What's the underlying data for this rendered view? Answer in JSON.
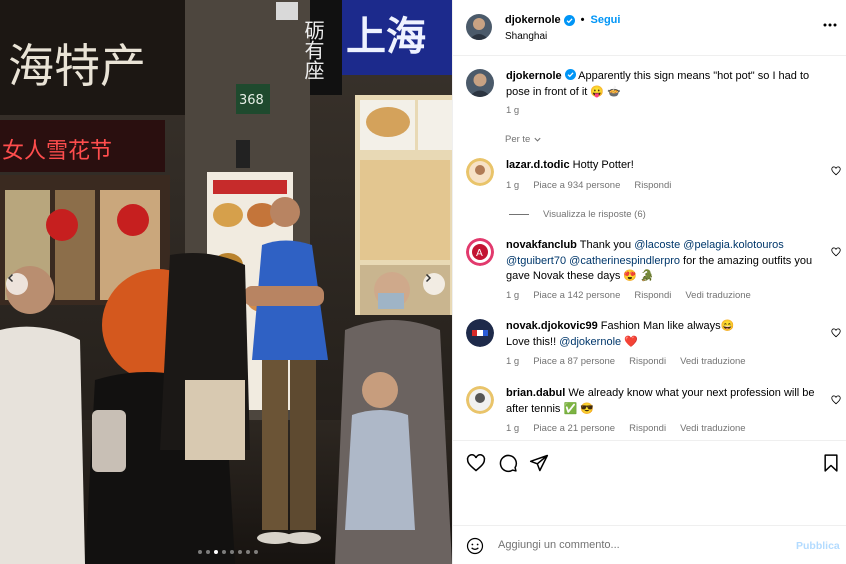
{
  "post": {
    "author": "djokernole",
    "follow_label": "Segui",
    "separator": "•",
    "location": "Shanghai",
    "caption": "Apparently this sign means \"hot pot\" so I had to pose in front of it 😛 🍲",
    "caption_time": "1 g",
    "for_you_label": "Per te",
    "photo": {
      "sign_top_left": "海特产",
      "sign_top_right": "上海",
      "sign_vertical": "砺有座",
      "sign_red": "女人雪花节",
      "address_number": "368",
      "carousel_total": 8,
      "carousel_active": 3
    }
  },
  "comments": [
    {
      "user": "lazar.d.todic",
      "text": "Hotty Potter!",
      "time": "1 g",
      "likes": "Piace a 934 persone",
      "reply": "Rispondi",
      "translate": "",
      "view_replies": "Visualizza le risposte (6)"
    },
    {
      "user": "novakfanclub",
      "text_before": "Thank you ",
      "mentions": [
        "@lacoste",
        "@pelagia.kolotouros",
        "@tguibert70",
        "@catherinespindlerpro"
      ],
      "text_after": " for the amazing outfits you gave Novak these days 😍 🐊",
      "time": "1 g",
      "likes": "Piace a 142 persone",
      "reply": "Rispondi",
      "translate": "Vedi traduzione"
    },
    {
      "user": "novak.djokovic99",
      "text": "Fashion Man like always😄",
      "line2_before": "Love this!! ",
      "line2_mention": "@djokernole",
      "line2_after": " ❤️",
      "time": "1 g",
      "likes": "Piace a 87 persone",
      "reply": "Rispondi",
      "translate": "Vedi traduzione"
    },
    {
      "user": "brian.dabul",
      "text": "We already know what your next profession will be after tennis ✅ 😎",
      "time": "1 g",
      "likes": "Piace a 21 persone",
      "reply": "Rispondi",
      "translate": "Vedi traduzione"
    }
  ],
  "composer": {
    "placeholder": "Aggiungi un commento...",
    "publish_label": "Pubblica"
  },
  "colors": {
    "accent": "#0095f6",
    "mention": "#00376b",
    "muted": "#737373",
    "publish_disabled": "#b3dbff",
    "heart_red": "#ed4956"
  },
  "icons": [
    "verified-badge-icon",
    "more-options-icon",
    "heart-icon",
    "comment-icon",
    "share-icon",
    "bookmark-icon",
    "emoji-icon",
    "chevron-left-icon",
    "chevron-right-icon",
    "chevron-down-icon"
  ]
}
